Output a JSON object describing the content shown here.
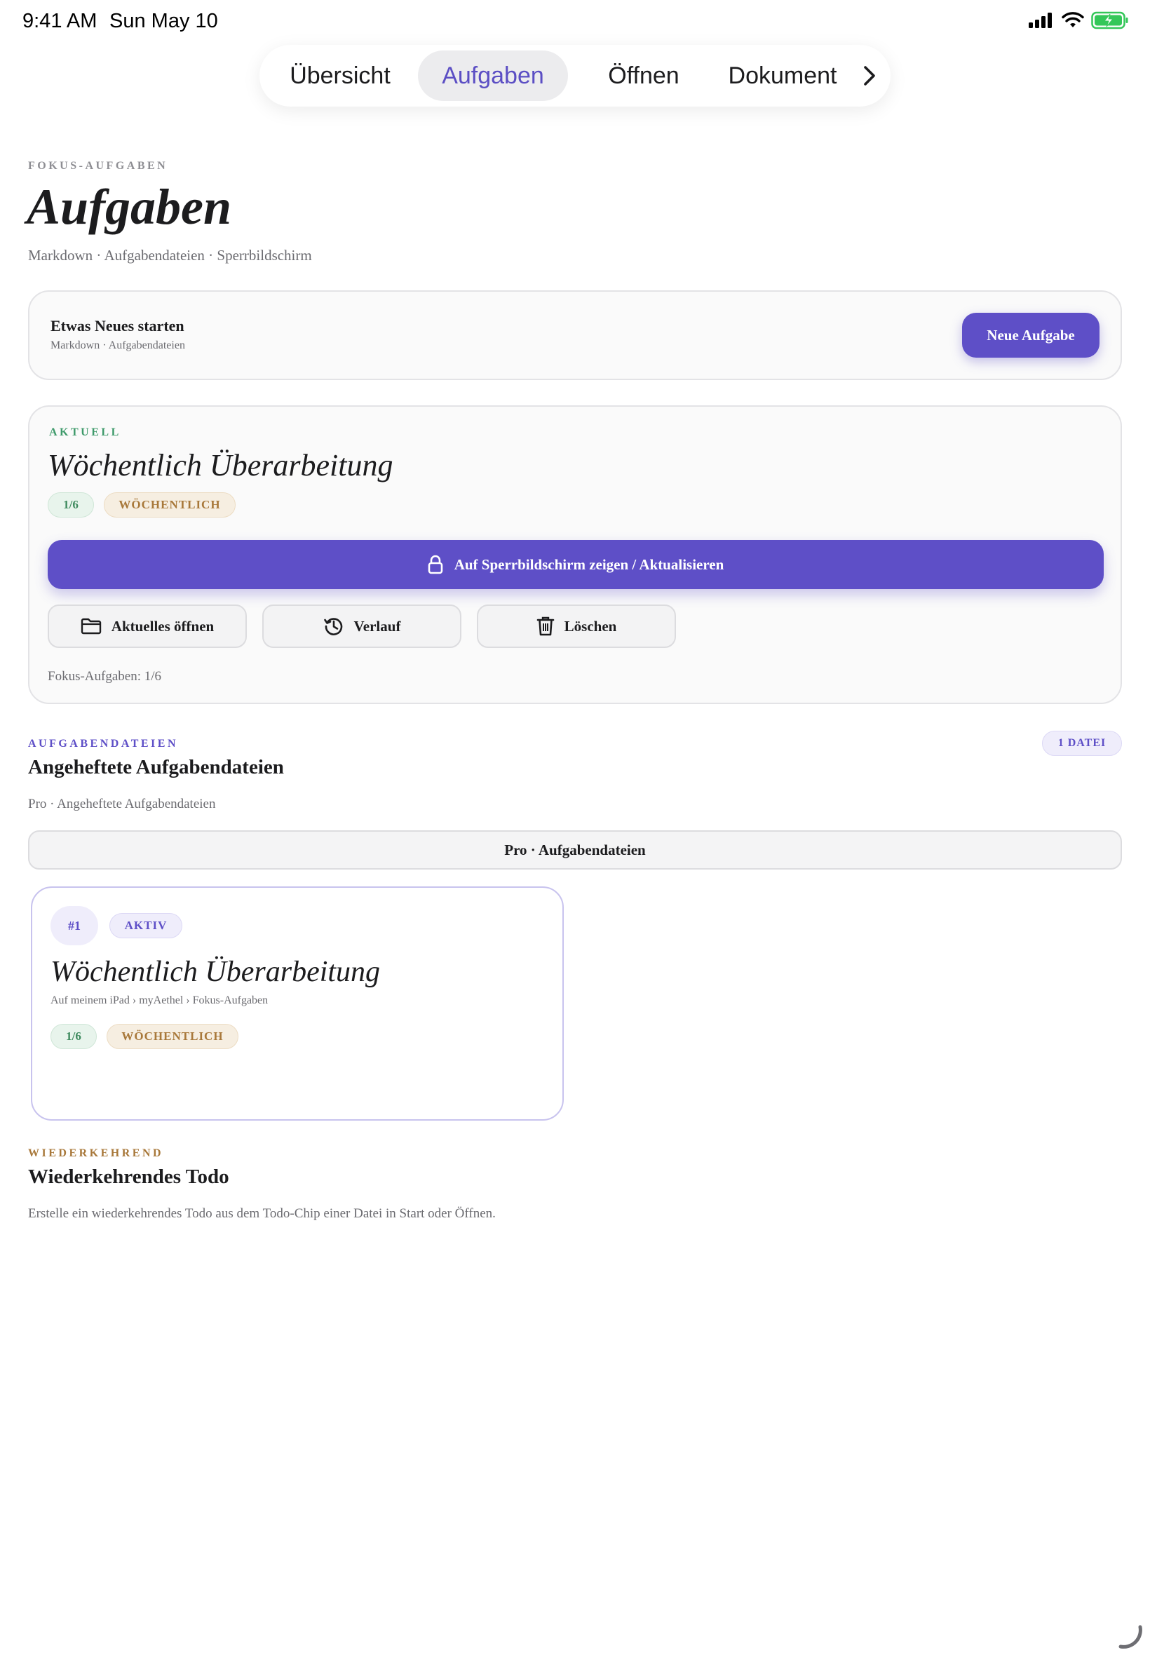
{
  "status_bar": {
    "time": "9:41 AM",
    "date": "Sun May 10",
    "icons": [
      "cellular-signal-icon",
      "wifi-icon",
      "battery-charging-icon"
    ],
    "battery_color": "#34c759"
  },
  "tabs": [
    {
      "label": "Übersicht",
      "selected": false
    },
    {
      "label": "Aufgaben",
      "selected": true
    },
    {
      "label": "Öffnen",
      "selected": false
    },
    {
      "label": "Dokument",
      "selected": false
    }
  ],
  "header": {
    "eyebrow": "FOKUS-AUFGABEN",
    "title": "Aufgaben",
    "subtitle": "Markdown · Aufgabendateien · Sperrbildschirm"
  },
  "start_card": {
    "title": "Etwas Neues starten",
    "subtitle": "Markdown · Aufgabendateien",
    "button_label": "Neue Aufgabe"
  },
  "current": {
    "eyebrow": "AKTUELL",
    "title": "Wöchentlich Überarbeitung",
    "progress": "1/6",
    "frequency": "WÖCHENTLICH",
    "lock_button": "Auf Sperrbildschirm zeigen / Aktualisieren",
    "open_button": "Aktuelles öffnen",
    "history_button": "Verlauf",
    "delete_button": "Löschen",
    "footer": "Fokus-Aufgaben: 1/6"
  },
  "files": {
    "eyebrow": "AUFGABENDATEIEN",
    "title": "Angeheftete Aufgabendateien",
    "subtitle": "Pro · Angeheftete Aufgabendateien",
    "count_badge": "1 DATEI",
    "pro_bar": "Pro · Aufgabendateien",
    "items": [
      {
        "index": "#1",
        "status": "AKTIV",
        "title": "Wöchentlich Überarbeitung",
        "path": "Auf meinem iPad › myAethel › Fokus-Aufgaben",
        "progress": "1/6",
        "frequency": "WÖCHENTLICH"
      }
    ]
  },
  "recurring": {
    "eyebrow": "WIEDERKEHREND",
    "title": "Wiederkehrendes Todo",
    "subtitle": "Erstelle ein wiederkehrendes Todo aus dem Todo-Chip einer Datei in Start oder Öffnen."
  },
  "colors": {
    "accent": "#5e4fc7",
    "green": "#3e9a6a",
    "tan": "#a8783a"
  }
}
